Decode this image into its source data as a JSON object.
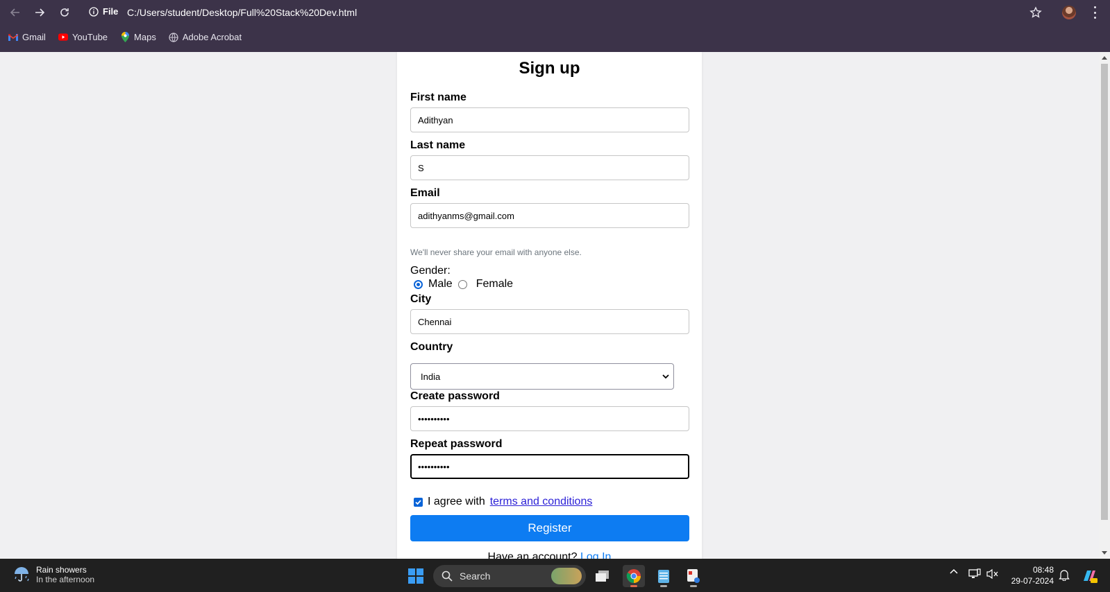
{
  "browser": {
    "url_scheme": "File",
    "url": "C:/Users/student/Desktop/Full%20Stack%20Dev.html",
    "bookmarks": [
      {
        "label": "Gmail",
        "icon": "gmail-icon"
      },
      {
        "label": "YouTube",
        "icon": "youtube-icon"
      },
      {
        "label": "Maps",
        "icon": "maps-icon"
      },
      {
        "label": "Adobe Acrobat",
        "icon": "globe-icon"
      }
    ]
  },
  "form": {
    "title": "Sign up",
    "first_name": {
      "label": "First name",
      "value": "Adithyan"
    },
    "last_name": {
      "label": "Last name",
      "value": "S"
    },
    "email": {
      "label": "Email",
      "value": "adithyanms@gmail.com",
      "help": "We'll never share your email with anyone else."
    },
    "gender": {
      "label": "Gender:",
      "options": [
        "Male",
        "Female"
      ],
      "selected": "Male"
    },
    "city": {
      "label": "City",
      "value": "Chennai"
    },
    "country": {
      "label": "Country",
      "selected": "India"
    },
    "create_password": {
      "label": "Create password",
      "value": "••••••••••"
    },
    "repeat_password": {
      "label": "Repeat password",
      "value": "••••••••••"
    },
    "agree_text": "I agree with",
    "terms_link": "terms and conditions",
    "agree_checked": true,
    "register_label": "Register",
    "have_account_text": "Have an account?",
    "login_link": "Log In"
  },
  "taskbar": {
    "weather_title": "Rain showers",
    "weather_sub": "In the afternoon",
    "search_placeholder": "Search",
    "time": "08:48",
    "date": "29-07-2024"
  },
  "colors": {
    "chrome_bg": "#3c3349",
    "accent": "#0d7cf2",
    "taskbar_bg": "#202020"
  }
}
